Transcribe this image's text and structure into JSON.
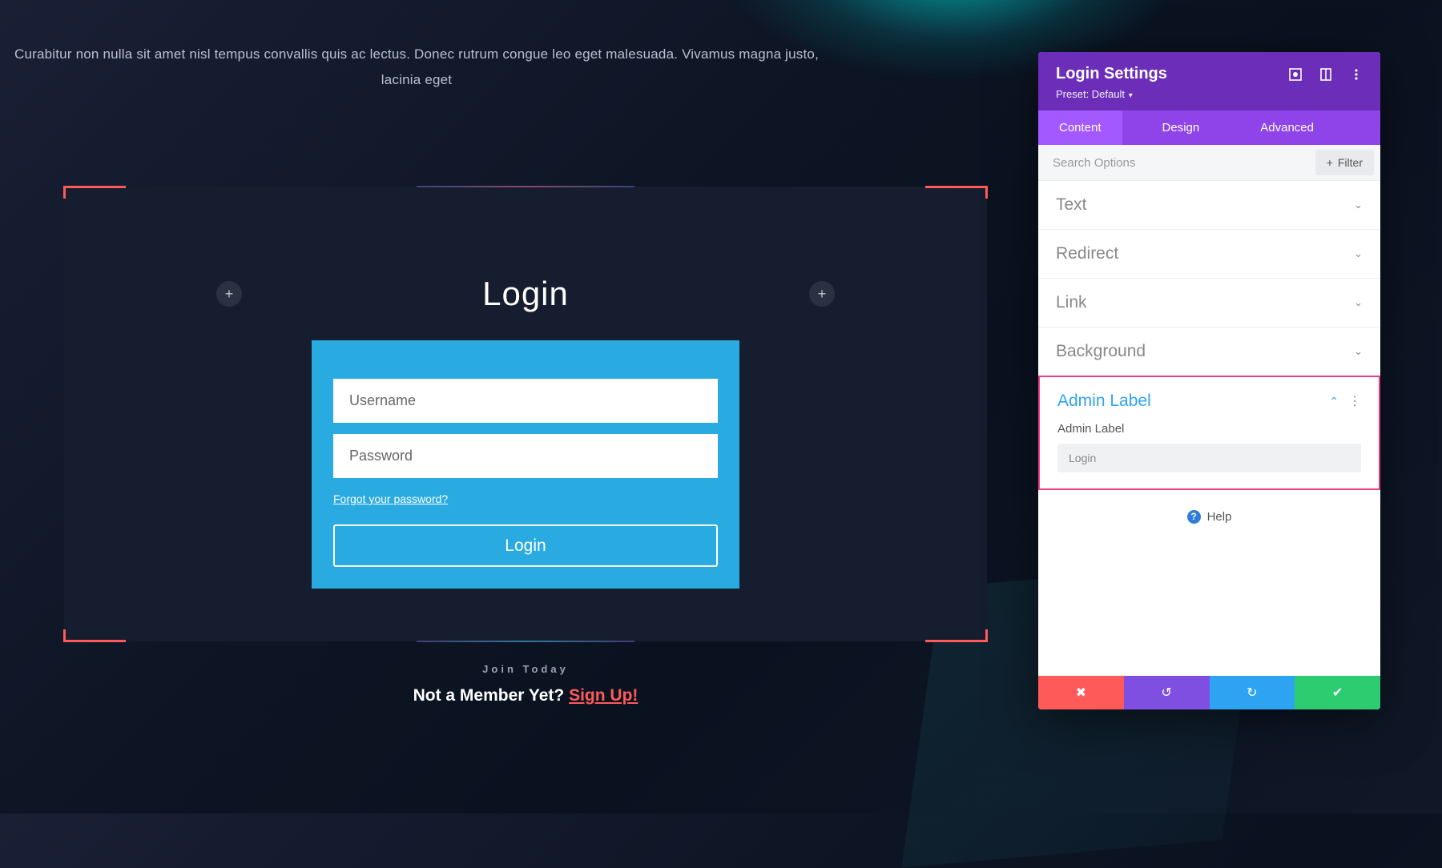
{
  "page": {
    "intro_text": "Curabitur non nulla sit amet nisl tempus convallis quis ac lectus. Donec rutrum congue leo eget malesuada. Vivamus magna justo, lacinia eget"
  },
  "login": {
    "title": "Login",
    "username_placeholder": "Username",
    "password_placeholder": "Password",
    "forgot_text": "Forgot your password?",
    "button_label": "Login"
  },
  "cta": {
    "eyebrow": "Join Today",
    "prompt": "Not a Member Yet? ",
    "signup_label": "Sign Up!"
  },
  "panel": {
    "title": "Login Settings",
    "preset_prefix": "Preset: ",
    "preset_value": "Default",
    "tabs": {
      "content": "Content",
      "design": "Design",
      "advanced": "Advanced"
    },
    "search_placeholder": "Search Options",
    "filter_label": "Filter",
    "sections": {
      "text": "Text",
      "redirect": "Redirect",
      "link": "Link",
      "background": "Background",
      "admin_label": "Admin Label"
    },
    "admin_field_label": "Admin Label",
    "admin_field_value": "Login",
    "help_label": "Help"
  }
}
